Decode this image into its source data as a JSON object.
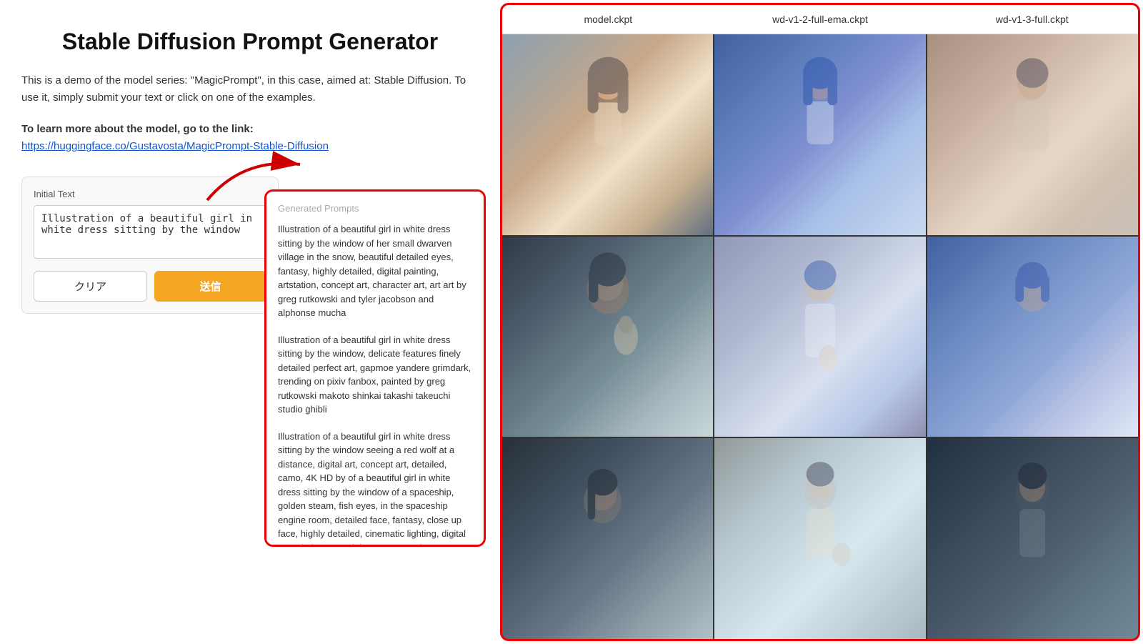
{
  "page": {
    "title": "Stable Diffusion Prompt Generator",
    "description": "This is a demo of the model series: \"MagicPrompt\", in this case, aimed at: Stable Diffusion. To use it, simply submit your text or click on one of the examples.",
    "learn_more_label": "To learn more about the model, go to the link:",
    "learn_more_url": "https://huggingface.co/Gustavosta/MagicPrompt-Stable-Diffusion",
    "learn_more_url_display": "https://huggingface.co/Gustavosta/MagicPrompt-Stable-Diffusion"
  },
  "input_section": {
    "label": "Initial Text",
    "placeholder": "Illustration of a beautiful girl in white dress sitting by the window",
    "value": "Illustration of a beautiful girl in white dress sitting by the window",
    "clear_button": "クリア",
    "submit_button": "送信"
  },
  "prompts_box": {
    "title": "Generated Prompts",
    "prompts": [
      "Illustration of a beautiful girl in white dress sitting by the window of her small dwarven village in the snow, beautiful detailed eyes, fantasy, highly detailed, digital painting, artstation, concept art, character art, art art by greg rutkowski and tyler jacobson and alphonse mucha",
      "Illustration of a beautiful girl in white dress sitting by the window, delicate features finely detailed perfect art, gapmoe yandere grimdark, trending on pixiv fanbox, painted by greg rutkowski makoto shinkai takashi takeuchi studio ghibli",
      "Illustration of a beautiful girl in white dress sitting by the window seeing a red wolf at a distance, digital art, concept art, detailed, camo, 4K HD by of a beautiful girl in white dress sitting by the window of a spaceship, golden steam, fish eyes, in the spaceship engine room, detailed face, fantasy, close up face, highly detailed, cinematic lighting, digital art painting artwork by artgerm and greg rutkowski"
    ]
  },
  "right_panel": {
    "headers": [
      "model.ckpt",
      "wd-v1-2-full-ema.ckpt",
      "wd-v1-3-full.ckpt"
    ],
    "images": [
      {
        "id": 1,
        "row": 1,
        "col": 1
      },
      {
        "id": 2,
        "row": 1,
        "col": 2
      },
      {
        "id": 3,
        "row": 1,
        "col": 3
      },
      {
        "id": 4,
        "row": 2,
        "col": 1
      },
      {
        "id": 5,
        "row": 2,
        "col": 2
      },
      {
        "id": 6,
        "row": 2,
        "col": 3
      },
      {
        "id": 7,
        "row": 3,
        "col": 1
      },
      {
        "id": 8,
        "row": 3,
        "col": 2
      },
      {
        "id": 9,
        "row": 3,
        "col": 3
      }
    ]
  }
}
